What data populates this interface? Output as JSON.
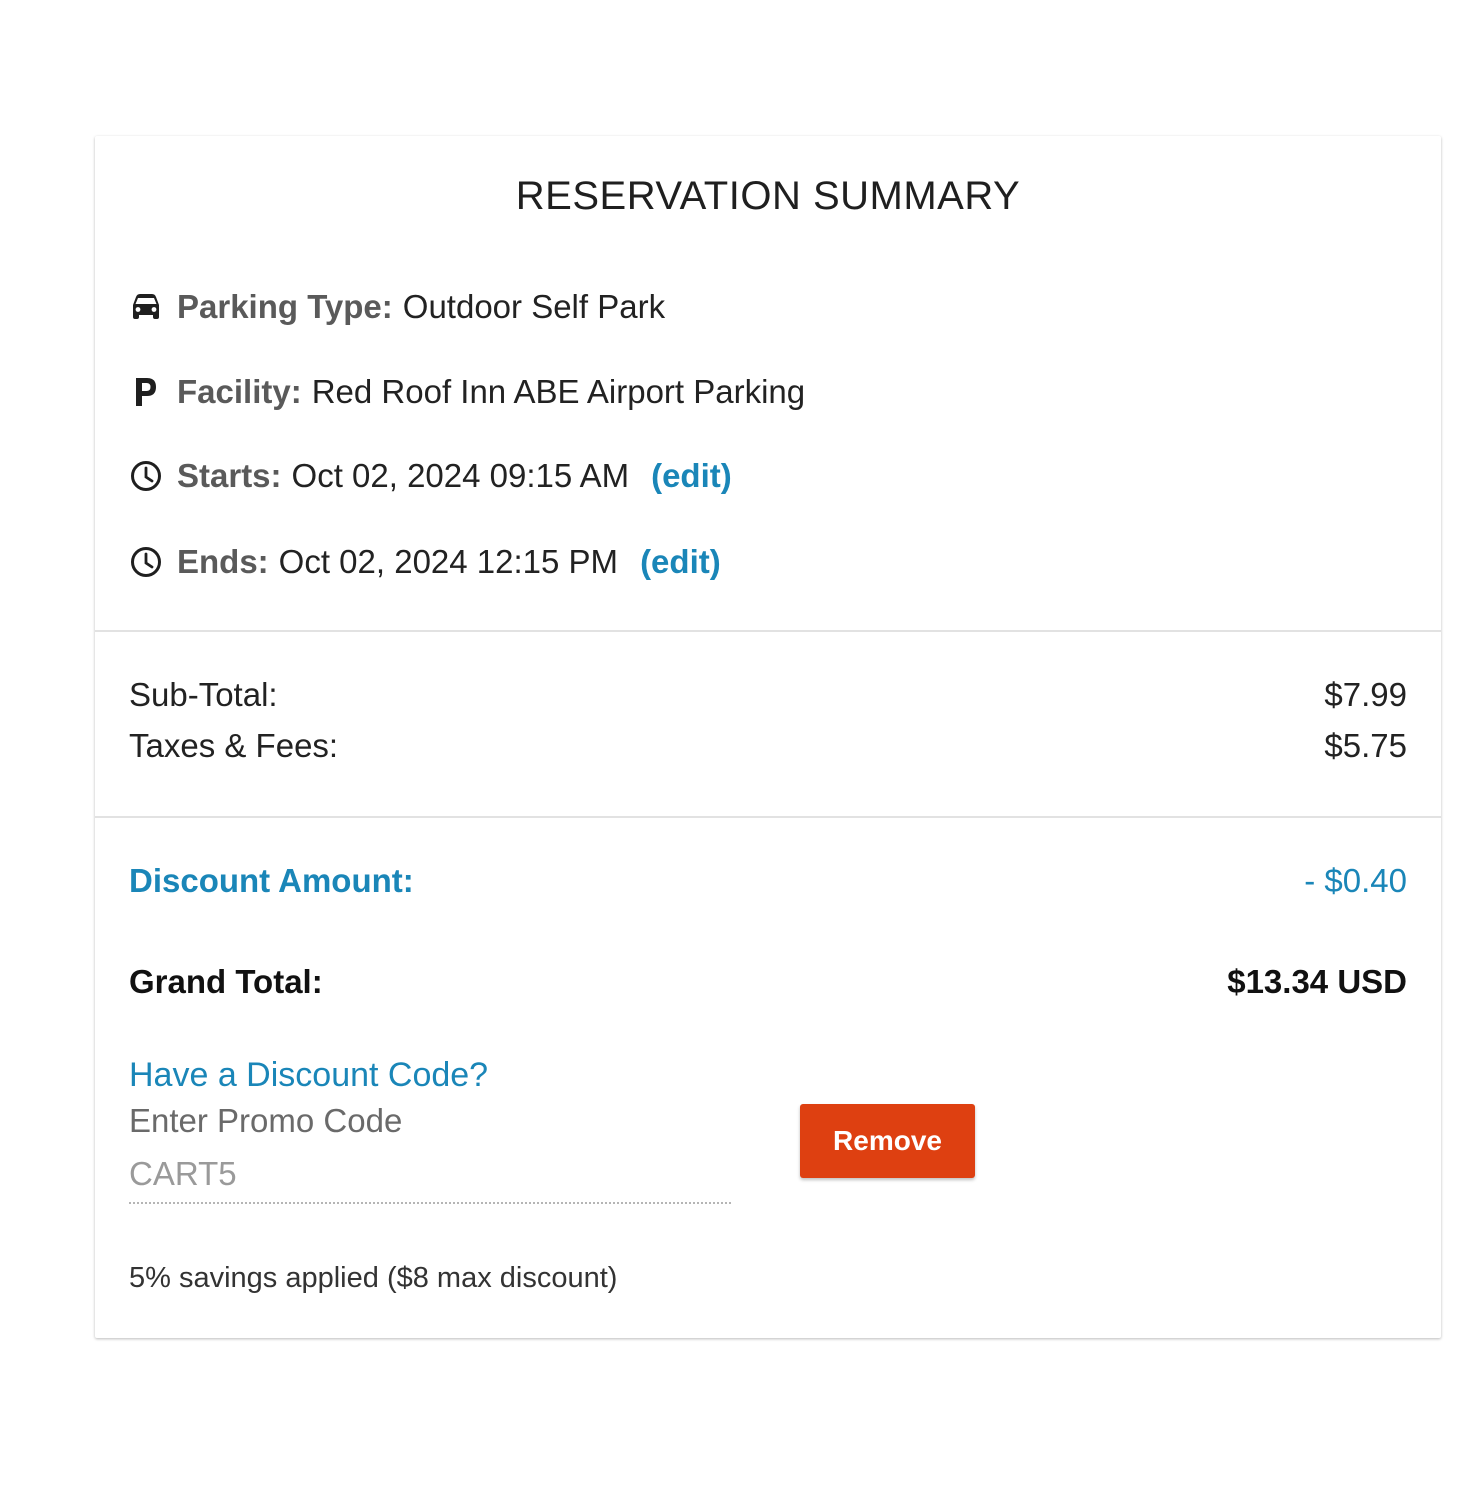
{
  "summary": {
    "title": "RESERVATION SUMMARY",
    "details": [
      {
        "icon": "car-icon",
        "label": "Parking Type:",
        "value": "Outdoor Self Park"
      },
      {
        "icon": "parking-p-icon",
        "label": "Facility:",
        "value": "Red Roof Inn ABE Airport Parking"
      },
      {
        "icon": "clock-icon",
        "label": "Starts:",
        "value": "Oct 02, 2024 09:15 AM",
        "edit": "(edit)"
      },
      {
        "icon": "clock-icon",
        "label": "Ends:",
        "value": "Oct 02, 2024 12:15 PM",
        "edit": "(edit)"
      }
    ]
  },
  "pricing": {
    "subtotal_label": "Sub-Total:",
    "subtotal_value": "$7.99",
    "taxes_label": "Taxes & Fees:",
    "taxes_value": "$5.75",
    "discount_label": "Discount Amount:",
    "discount_value": "- $0.40",
    "grand_total_label": "Grand Total:",
    "grand_total_value": "$13.34 USD"
  },
  "promo": {
    "title": "Have a Discount Code?",
    "field_label": "Enter Promo Code",
    "code_value": "CART5",
    "remove_label": "Remove",
    "savings_note": "5% savings applied ($8 max discount)"
  },
  "colors": {
    "accent": "#1a86b8",
    "remove_button": "#de4011",
    "label_gray": "#5a5a5a"
  }
}
